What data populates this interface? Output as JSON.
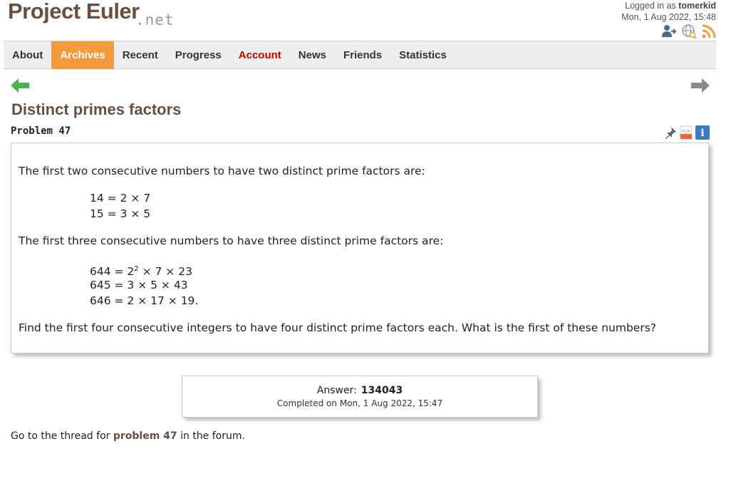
{
  "logo": {
    "main": "Project Euler",
    "suffix": ".net"
  },
  "login": {
    "prefix": "Logged in as",
    "user": "tomerkid",
    "datetime": "Mon, 1 Aug 2022, 15:48"
  },
  "nav": {
    "items": [
      {
        "label": "About"
      },
      {
        "label": "Archives"
      },
      {
        "label": "Recent"
      },
      {
        "label": "Progress"
      },
      {
        "label": "Account"
      },
      {
        "label": "News"
      },
      {
        "label": "Friends"
      },
      {
        "label": "Statistics"
      }
    ]
  },
  "problem": {
    "title": "Distinct primes factors",
    "number": "Problem 47",
    "para1": "The first two consecutive numbers to have two distinct prime factors are:",
    "eq1": [
      "14 = 2 × 7",
      "15 = 3 × 5"
    ],
    "para2": "The first three consecutive numbers to have three distinct prime factors are:",
    "eq2": {
      "line1_pre": "644 = 2",
      "line1_sup": "2",
      "line1_post": " × 7 × 23",
      "line2": "645 = 3 × 5 × 43",
      "line3": "646 = 2 × 17 × 19."
    },
    "para3": "Find the first four consecutive integers to have four distinct prime factors each. What is the first of these numbers?"
  },
  "answer": {
    "label": "Answer:",
    "value": "134043",
    "completed": "Completed on Mon, 1 Aug 2022, 15:47"
  },
  "forum": {
    "pre": "Go to the thread for",
    "link": "problem 47",
    "post": "in the forum."
  },
  "icons": {
    "user": "add-friend-icon",
    "globe": "language-icon",
    "rss": "rss-icon",
    "prev": "previous-arrow-icon",
    "next": "next-arrow-icon",
    "pin": "pin-icon",
    "html": "html-icon",
    "info": "info-icon"
  },
  "colors": {
    "brand": "#6b4e3d",
    "active_tab": "#f49a3c",
    "account": "#cc0000",
    "rss": "#f49a3c"
  }
}
